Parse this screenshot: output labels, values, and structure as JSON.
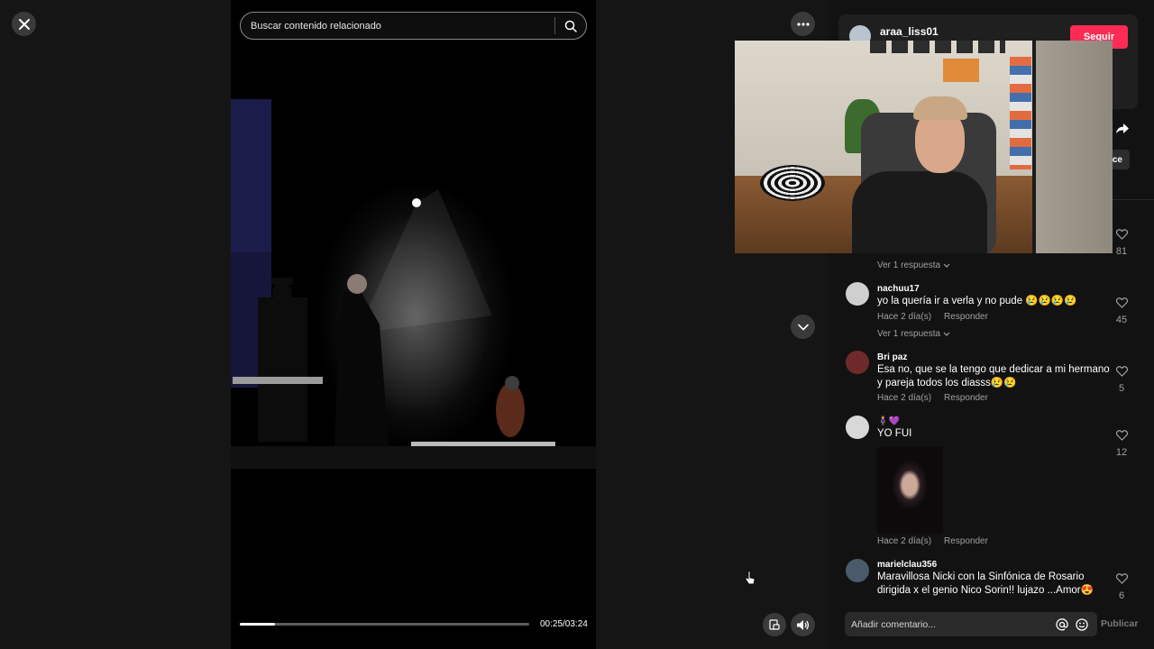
{
  "search": {
    "placeholder": "Buscar contenido relacionado"
  },
  "player": {
    "time": "00:25/03:24",
    "progress": 0.123
  },
  "author": {
    "username": "araa_liss01",
    "follow_label": "Seguir",
    "copy_label": "ce"
  },
  "comments": [
    {
      "id": "c0",
      "reply_toggle": "Ver 1 respuesta",
      "likes": "81"
    },
    {
      "id": "c1",
      "username": "nachuu17",
      "text": "yo la quería ir a verla y no pude 😢😢😢😢",
      "time": "Hace 2 día(s)",
      "reply": "Responder",
      "likes": "45",
      "reply_toggle": "Ver 1 respuesta"
    },
    {
      "id": "c2",
      "username": "Bri paz",
      "text": "Esa no, que se la tengo que dedicar a mi hermano y pareja todos los diasss😢😢",
      "time": "Hace 2 día(s)",
      "reply": "Responder",
      "likes": "5"
    },
    {
      "id": "c3",
      "username": "🧍‍♀️💜",
      "text": "YO FUI",
      "time": "Hace 2 día(s)",
      "reply": "Responder",
      "likes": "12"
    },
    {
      "id": "c4",
      "username": "marielclau356",
      "text": "Maravillosa Nicki con la Sinfónica de Rosario dirigida x el genio Nico Sorin!! lujazo ...Amor😍",
      "likes": "6"
    }
  ],
  "composer": {
    "placeholder": "Añadir comentario...",
    "publish_label": "Publicar"
  },
  "colors": {
    "accent": "#fe2c55",
    "panel_bg": "#121212",
    "stage_bg": "#151515"
  },
  "icons": [
    "close-icon",
    "search-icon",
    "more-icon",
    "chevron-down-icon",
    "pip-icon",
    "volume-icon",
    "share-icon",
    "heart-icon",
    "at-icon",
    "emoji-icon",
    "pointer-cursor-icon"
  ]
}
